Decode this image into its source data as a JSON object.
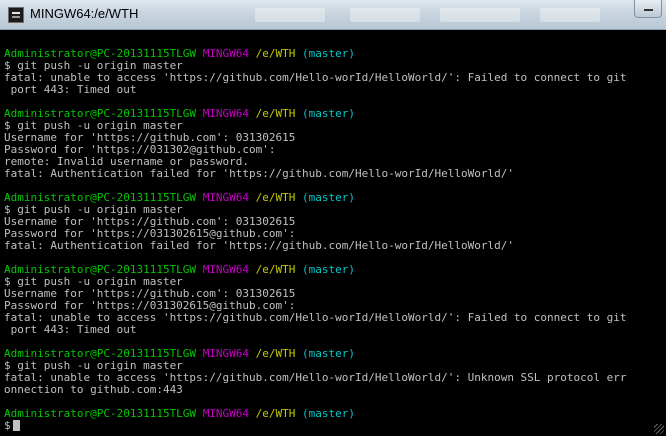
{
  "window": {
    "title": "MINGW64:/e/WTH"
  },
  "prompt": {
    "user": "Administrator@PC-20131115TLGW",
    "shell": "MINGW64",
    "path": "/e/WTH",
    "branch": "(master)"
  },
  "colors": {
    "user": "#00c800",
    "shell": "#c800c8",
    "path": "#c8c800",
    "branch": "#00c8c8",
    "output": "#c0c0c0",
    "background": "#000000"
  },
  "lines": [
    {
      "type": "blank"
    },
    {
      "type": "prompt"
    },
    {
      "type": "text",
      "text": "$ git push -u origin master"
    },
    {
      "type": "text",
      "text": "fatal: unable to access 'https://github.com/Hello-worId/HelloWorld/': Failed to connect to git"
    },
    {
      "type": "text",
      "text": " port 443: Timed out"
    },
    {
      "type": "blank"
    },
    {
      "type": "prompt"
    },
    {
      "type": "text",
      "text": "$ git push -u origin master"
    },
    {
      "type": "text",
      "text": "Username for 'https://github.com': 031302615"
    },
    {
      "type": "text",
      "text": "Password for 'https://031302@github.com':"
    },
    {
      "type": "text",
      "text": "remote: Invalid username or password."
    },
    {
      "type": "text",
      "text": "fatal: Authentication failed for 'https://github.com/Hello-worId/HelloWorld/'"
    },
    {
      "type": "blank"
    },
    {
      "type": "prompt"
    },
    {
      "type": "text",
      "text": "$ git push -u origin master"
    },
    {
      "type": "text",
      "text": "Username for 'https://github.com': 031302615"
    },
    {
      "type": "text",
      "text": "Password for 'https://031302615@github.com':"
    },
    {
      "type": "text",
      "text": "fatal: Authentication failed for 'https://github.com/Hello-worId/HelloWorld/'"
    },
    {
      "type": "blank"
    },
    {
      "type": "prompt"
    },
    {
      "type": "text",
      "text": "$ git push -u origin master"
    },
    {
      "type": "text",
      "text": "Username for 'https://github.com': 031302615"
    },
    {
      "type": "text",
      "text": "Password for 'https://031302615@github.com':"
    },
    {
      "type": "text",
      "text": "fatal: unable to access 'https://github.com/Hello-worId/HelloWorld/': Failed to connect to git"
    },
    {
      "type": "text",
      "text": " port 443: Timed out"
    },
    {
      "type": "blank"
    },
    {
      "type": "prompt"
    },
    {
      "type": "text",
      "text": "$ git push -u origin master"
    },
    {
      "type": "text",
      "text": "fatal: unable to access 'https://github.com/Hello-worId/HelloWorld/': Unknown SSL protocol err"
    },
    {
      "type": "text",
      "text": "onnection to github.com:443"
    },
    {
      "type": "blank"
    },
    {
      "type": "prompt"
    },
    {
      "type": "text",
      "text": "$",
      "cursor": true
    }
  ]
}
